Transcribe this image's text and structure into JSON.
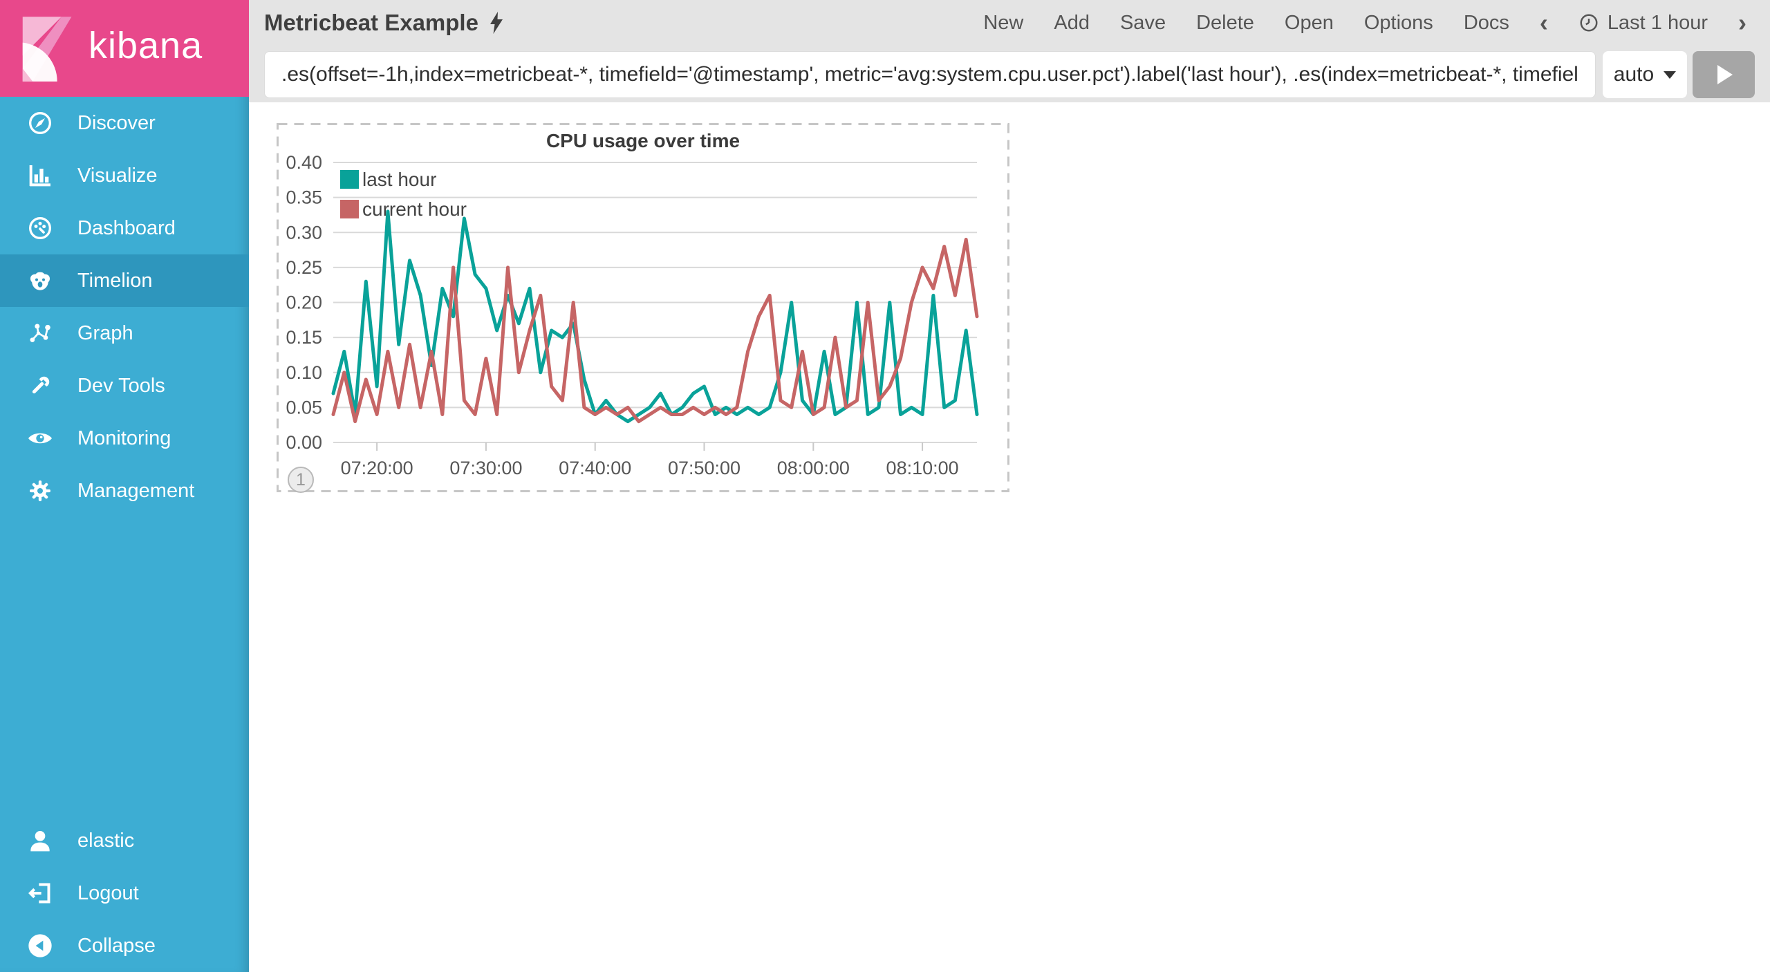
{
  "sidebar": {
    "logo_text": "kibana",
    "items": [
      {
        "icon": "compass-icon",
        "label": "Discover",
        "active": false
      },
      {
        "icon": "bar-chart-icon",
        "label": "Visualize",
        "active": false
      },
      {
        "icon": "dashboard-icon",
        "label": "Dashboard",
        "active": false
      },
      {
        "icon": "sea-lion-icon",
        "label": "Timelion",
        "active": true
      },
      {
        "icon": "graph-icon",
        "label": "Graph",
        "active": false
      },
      {
        "icon": "wrench-icon",
        "label": "Dev Tools",
        "active": false
      },
      {
        "icon": "eye-icon",
        "label": "Monitoring",
        "active": false
      },
      {
        "icon": "gear-icon",
        "label": "Management",
        "active": false
      }
    ],
    "footer_items": [
      {
        "icon": "user-icon",
        "label": "elastic"
      },
      {
        "icon": "logout-icon",
        "label": "Logout"
      },
      {
        "icon": "collapse-circle-icon",
        "label": "Collapse"
      }
    ]
  },
  "topbar": {
    "title": "Metricbeat Example",
    "title_icon": "lightning-bolt-icon",
    "menu": [
      "New",
      "Add",
      "Save",
      "Delete",
      "Open",
      "Options",
      "Docs"
    ],
    "prev_label": "‹",
    "next_label": "›",
    "time_picker": "Last 1 hour"
  },
  "query": {
    "value": ".es(offset=-1h,index=metricbeat-*, timefield='@timestamp', metric='avg:system.cpu.user.pct').label('last hour'), .es(index=metricbeat-*, timefield",
    "interval_label": "auto"
  },
  "panel": {
    "badge": "1"
  },
  "chart_data": {
    "type": "line",
    "title": "CPU usage over time",
    "x_times": [
      "07:16:00",
      "07:17:00",
      "07:18:00",
      "07:19:00",
      "07:20:00",
      "07:21:00",
      "07:22:00",
      "07:23:00",
      "07:24:00",
      "07:25:00",
      "07:26:00",
      "07:27:00",
      "07:28:00",
      "07:29:00",
      "07:30:00",
      "07:31:00",
      "07:32:00",
      "07:33:00",
      "07:34:00",
      "07:35:00",
      "07:36:00",
      "07:37:00",
      "07:38:00",
      "07:39:00",
      "07:40:00",
      "07:41:00",
      "07:42:00",
      "07:43:00",
      "07:44:00",
      "07:45:00",
      "07:46:00",
      "07:47:00",
      "07:48:00",
      "07:49:00",
      "07:50:00",
      "07:51:00",
      "07:52:00",
      "07:53:00",
      "07:54:00",
      "07:55:00",
      "07:56:00",
      "07:57:00",
      "07:58:00",
      "07:59:00",
      "08:00:00",
      "08:01:00",
      "08:02:00",
      "08:03:00",
      "08:04:00",
      "08:05:00",
      "08:06:00",
      "08:07:00",
      "08:08:00",
      "08:09:00",
      "08:10:00",
      "08:11:00",
      "08:12:00",
      "08:13:00",
      "08:14:00",
      "08:15:00"
    ],
    "series": [
      {
        "name": "last hour",
        "color": "#09a299",
        "values": [
          0.07,
          0.13,
          0.04,
          0.23,
          0.08,
          0.33,
          0.14,
          0.26,
          0.21,
          0.11,
          0.22,
          0.18,
          0.32,
          0.24,
          0.22,
          0.16,
          0.21,
          0.17,
          0.22,
          0.1,
          0.16,
          0.15,
          0.17,
          0.09,
          0.04,
          0.06,
          0.04,
          0.03,
          0.04,
          0.05,
          0.07,
          0.04,
          0.05,
          0.07,
          0.08,
          0.04,
          0.05,
          0.04,
          0.05,
          0.04,
          0.05,
          0.1,
          0.2,
          0.06,
          0.04,
          0.13,
          0.04,
          0.05,
          0.2,
          0.04,
          0.05,
          0.2,
          0.04,
          0.05,
          0.04,
          0.21,
          0.05,
          0.06,
          0.16,
          0.04
        ]
      },
      {
        "name": "current hour",
        "color": "#c66565",
        "values": [
          0.04,
          0.1,
          0.03,
          0.09,
          0.04,
          0.13,
          0.05,
          0.14,
          0.05,
          0.13,
          0.04,
          0.25,
          0.06,
          0.04,
          0.12,
          0.04,
          0.25,
          0.1,
          0.16,
          0.21,
          0.08,
          0.06,
          0.2,
          0.05,
          0.04,
          0.05,
          0.04,
          0.05,
          0.03,
          0.04,
          0.05,
          0.04,
          0.04,
          0.05,
          0.04,
          0.05,
          0.04,
          0.05,
          0.13,
          0.18,
          0.21,
          0.06,
          0.05,
          0.13,
          0.04,
          0.05,
          0.15,
          0.05,
          0.06,
          0.2,
          0.06,
          0.08,
          0.12,
          0.2,
          0.25,
          0.22,
          0.28,
          0.21,
          0.29,
          0.18
        ]
      }
    ],
    "x_ticks": [
      "07:20:00",
      "07:30:00",
      "07:40:00",
      "07:50:00",
      "08:00:00",
      "08:10:00"
    ],
    "y_ticks": [
      "0.00",
      "0.05",
      "0.10",
      "0.15",
      "0.20",
      "0.25",
      "0.30",
      "0.35",
      "0.40"
    ],
    "ylim": [
      0,
      0.4
    ],
    "grid": true,
    "legend_position": "top-left"
  },
  "colors": {
    "sidebar_bg": "#3dadd3",
    "sidebar_active_bg": "#2e96bd",
    "logo_bg": "#e8488b",
    "topbar_bg": "#e4e4e4",
    "topbar_text": "#555555",
    "title_text": "#3f3f3f",
    "panel_border": "#c6c6c6",
    "grid": "#d9d9d9",
    "axis_text": "#565656",
    "play_bg": "#a6a6a6"
  }
}
